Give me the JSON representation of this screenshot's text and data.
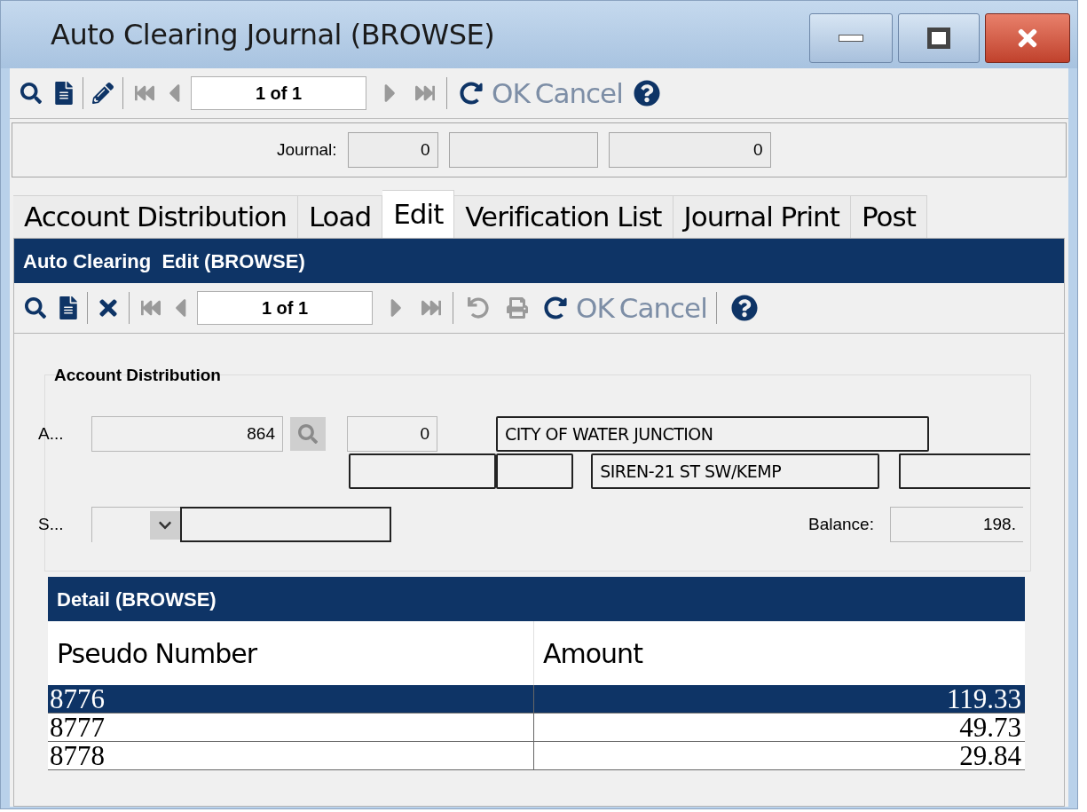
{
  "window": {
    "title": "Auto Clearing Journal (BROWSE)"
  },
  "toolbar": {
    "record": "1 of 1",
    "actions": [
      {
        "label": "OK",
        "disabled": true
      },
      {
        "label": "Cancel",
        "disabled": true
      }
    ]
  },
  "journal": {
    "label": "Journal:",
    "number": "0",
    "amount": "0"
  },
  "tabs": [
    {
      "label": "Account Distribution",
      "selected": false
    },
    {
      "label": "Load",
      "selected": false
    },
    {
      "label": "Edit",
      "selected": true
    },
    {
      "label": "Verification List",
      "selected": false
    },
    {
      "label": "Journal Print",
      "selected": false
    },
    {
      "label": "Post",
      "selected": false
    }
  ],
  "edit_panel": {
    "title": "Auto Clearing  Edit (BROWSE)",
    "toolbar": {
      "record": "1 of 1",
      "actions": [
        {
          "label": "OK",
          "disabled": true
        },
        {
          "label": "Cancel",
          "disabled": true
        }
      ]
    },
    "group": {
      "title": "Account Distribution",
      "account_label": "A...",
      "account": "864",
      "number": "0",
      "name": "CITY OF WATER JUNCTION",
      "address": "SIREN-21 ST SW/KEMP",
      "s_label": "S...",
      "balance_label": "Balance:",
      "balance": "198."
    },
    "detail": {
      "title": "Detail (BROWSE)",
      "columns": [
        "Pseudo Number",
        "Amount"
      ],
      "rows": [
        {
          "cells": [
            "8776",
            "119.33"
          ],
          "selected": true
        },
        {
          "cells": [
            "8777",
            "49.73"
          ],
          "selected": false
        },
        {
          "cells": [
            "8778",
            "29.84"
          ],
          "selected": false
        }
      ]
    }
  }
}
